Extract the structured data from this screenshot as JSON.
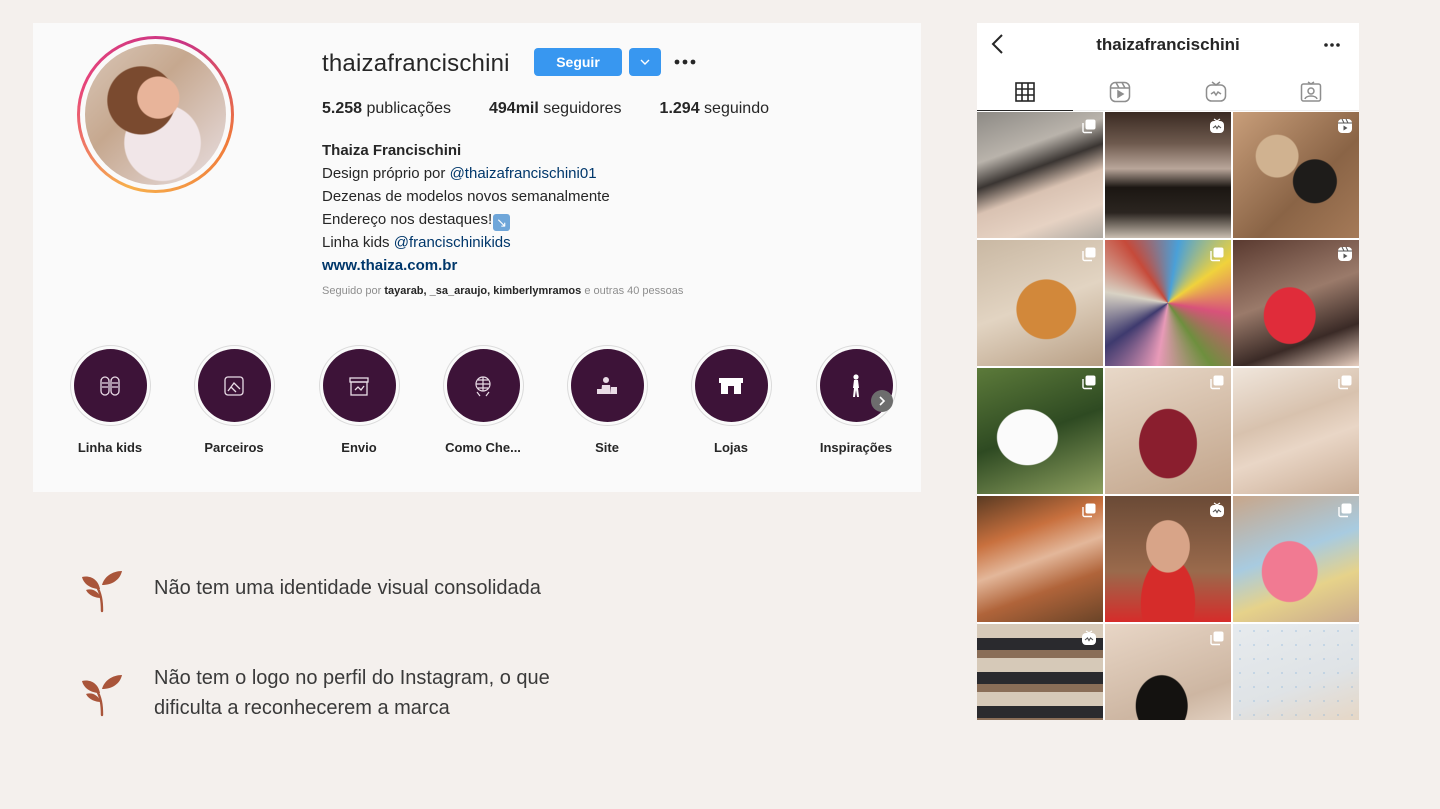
{
  "desktop_profile": {
    "username": "thaizafrancischini",
    "follow_label": "Seguir",
    "stats": [
      {
        "value": "5.258",
        "label": "publicações"
      },
      {
        "value": "494mil",
        "label": "seguidores"
      },
      {
        "value": "1.294",
        "label": "seguindo"
      }
    ],
    "bio": {
      "name": "Thaiza Francischini",
      "line1_prefix": "Design próprio por ",
      "line1_mention": "@thaizafrancischini01",
      "line2": "Dezenas de modelos novos semanalmente",
      "line3": "Endereço nos destaques!",
      "line3_emoji": "↘",
      "line4_prefix": "Linha kids ",
      "line4_mention": "@francischinikids",
      "website": "www.thaiza.com.br"
    },
    "followed_by": {
      "prefix": "Seguido por ",
      "users": "tayarab, _sa_araujo, kimberlymramos",
      "suffix": " e outras 40 pessoas"
    },
    "highlights": [
      {
        "label": "Linha kids",
        "icon": "sandals-icon"
      },
      {
        "label": "Parceiros",
        "icon": "handshake-icon"
      },
      {
        "label": "Envio",
        "icon": "package-icon"
      },
      {
        "label": "Como Che...",
        "icon": "globe-icon"
      },
      {
        "label": "Site",
        "icon": "shopper-icon"
      },
      {
        "label": "Lojas",
        "icon": "store-icon"
      },
      {
        "label": "Inspirações",
        "icon": "woman-icon"
      }
    ],
    "colors": {
      "follow_blue": "#3897f0",
      "highlight_bg": "#3d1338",
      "mention": "#00376b"
    }
  },
  "notes": [
    {
      "text": "Não tem uma identidade visual consolidada"
    },
    {
      "text": "Não tem o logo no perfil do Instagram, o que dificulta  a reconhecerem a marca"
    }
  ],
  "mobile_profile": {
    "title": "thaizafrancischini",
    "tabs": [
      "grid-icon",
      "reels-icon",
      "igtv-icon",
      "tagged-icon"
    ],
    "grid_badges": [
      "multi",
      "igtv",
      "reels",
      "multi",
      "multi",
      "reels",
      "multi",
      "multi",
      "multi",
      "multi",
      "igtv",
      "multi",
      "igtv",
      "multi",
      "none"
    ]
  },
  "colors": {
    "background": "#f4f0ed",
    "sprout": "#a9553a"
  }
}
